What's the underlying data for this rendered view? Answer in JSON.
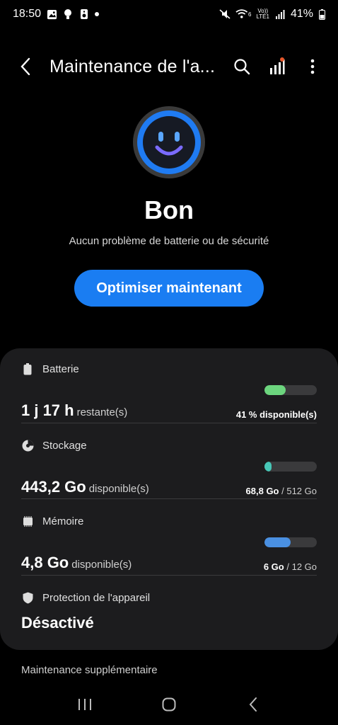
{
  "status_bar": {
    "time": "18:50",
    "battery_pct": "41%",
    "volte_label": "Vo))",
    "lte_label": "LTE1",
    "wifi_badge": "6"
  },
  "app_bar": {
    "title": "Maintenance de l'a...",
    "has_notification_dot": true
  },
  "hero": {
    "status": "Bon",
    "description": "Aucun problème de batterie ou de sécurité",
    "optimize_button": "Optimiser maintenant",
    "accent_color": "#1a7df2"
  },
  "battery": {
    "label": "Batterie",
    "value": "1 j 17 h",
    "unit": "restante(s)",
    "info": "41 % disponible(s)",
    "fill_fraction": 0.41,
    "bar_color": "#6cd57e"
  },
  "storage": {
    "label": "Stockage",
    "value": "443,2 Go",
    "unit": "disponible(s)",
    "used": "68,8 Go",
    "total": "/ 512 Go",
    "fill_fraction": 0.134,
    "bar_color": "#47c7b7"
  },
  "memory": {
    "label": "Mémoire",
    "value": "4,8 Go",
    "unit": "disponible(s)",
    "used": "6 Go",
    "total": "/ 12 Go",
    "fill_fraction": 0.5,
    "bar_color": "#4a90e2"
  },
  "protection": {
    "label": "Protection de l'appareil",
    "value": "Désactivé"
  },
  "more_section": {
    "label": "Maintenance supplémentaire"
  }
}
